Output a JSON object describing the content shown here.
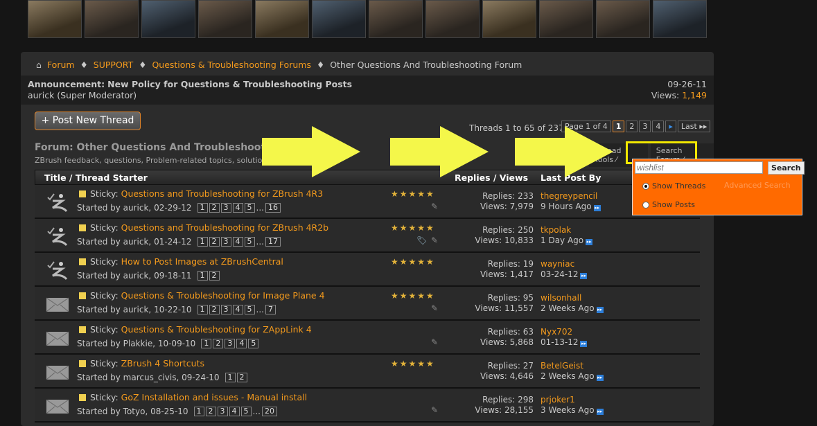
{
  "breadcrumb": {
    "items": [
      "Forum",
      "SUPPORT",
      "Questions & Troubleshooting Forums"
    ],
    "current": "Other Questions And Troubleshooting Forum"
  },
  "announcement": {
    "label": "Announcement:",
    "title": "New Policy for Questions & Troubleshooting Posts",
    "author": "aurick (Super Moderator)",
    "date": "09-26-11",
    "views_label": "Views:",
    "views": "1,149"
  },
  "post_button": "+ Post New Thread",
  "thread_count": "Threads 1 to 65 of 237",
  "pager": {
    "label": "Page 1 of 4",
    "pages": [
      "1",
      "2",
      "3",
      "4"
    ],
    "next": "▸",
    "last": "Last ▸▸"
  },
  "forum": {
    "title": "Forum: Other Questions And Troubleshooting Forum",
    "description": "ZBrush feedback, questions, Problem-related topics, solutions and suggestions"
  },
  "tabs": {
    "tools": "Thread Tools ⁄",
    "search": "Search Forum ⁄"
  },
  "columns": {
    "title": "Title / Thread Starter",
    "replies": "Replies / Views",
    "last": "Last Post By"
  },
  "threads": [
    {
      "prefix": "Sticky:",
      "title": "Questions and Troubleshooting for ZBrush 4R3",
      "starter": "Started by aurick, 02-29-12",
      "pages": [
        "1",
        "2",
        "3",
        "4",
        "5",
        "...",
        "16"
      ],
      "stars": "★★★★★",
      "replies": "Replies: 233",
      "views": "Views: 7,979",
      "last_user": "thegreypencil",
      "last_time": "9 Hours Ago",
      "icon": "zbrush"
    },
    {
      "prefix": "Sticky:",
      "title": "Questions and Troubleshooting for ZBrush 4R2b",
      "starter": "Started by aurick, 01-24-12",
      "pages": [
        "1",
        "2",
        "3",
        "4",
        "5",
        "...",
        "17"
      ],
      "stars": "★★★★★",
      "replies": "Replies: 250",
      "views": "Views: 10,833",
      "last_user": "tkpolak",
      "last_time": "1 Day Ago",
      "icon": "zbrush",
      "tag": true
    },
    {
      "prefix": "Sticky:",
      "title": "How to Post Images at ZBrushCentral",
      "starter": "Started by aurick, 09-18-11",
      "pages": [
        "1",
        "2"
      ],
      "stars": "★★★★★",
      "replies": "Replies: 19",
      "views": "Views: 1,417",
      "last_user": "wayniac",
      "last_time": "03-24-12",
      "icon": "zbrush",
      "nopen": true
    },
    {
      "prefix": "Sticky:",
      "title": "Questions & Troubleshooting for Image Plane 4",
      "starter": "Started by aurick, 10-22-10",
      "pages": [
        "1",
        "2",
        "3",
        "4",
        "5",
        "...",
        "7"
      ],
      "stars": "★★★★★",
      "replies": "Replies: 95",
      "views": "Views: 11,557",
      "last_user": "wilsonhall",
      "last_time": "2 Weeks Ago",
      "icon": "envelope"
    },
    {
      "prefix": "Sticky:",
      "title": "Questions & Troubleshooting for ZAppLink 4",
      "starter": "Started by Plakkie, 10-09-10",
      "pages": [
        "1",
        "2",
        "3",
        "4",
        "5"
      ],
      "stars": "",
      "replies": "Replies: 63",
      "views": "Views: 5,868",
      "last_user": "Nyx702",
      "last_time": "01-13-12",
      "icon": "envelope"
    },
    {
      "prefix": "Sticky:",
      "title": "ZBrush 4 Shortcuts",
      "starter": "Started by marcus_civis, 09-24-10",
      "pages": [
        "1",
        "2"
      ],
      "stars": "★★★★★",
      "replies": "Replies: 27",
      "views": "Views: 4,646",
      "last_user": "BetelGeist",
      "last_time": "2 Weeks Ago",
      "icon": "envelope",
      "nopen": true
    },
    {
      "prefix": "Sticky:",
      "title": "GoZ Installation and issues - Manual install",
      "starter": "Started by Totyo, 08-25-10",
      "pages": [
        "1",
        "2",
        "3",
        "4",
        "5",
        "...",
        "20"
      ],
      "stars": "",
      "replies": "Replies: 298",
      "views": "Views: 28,155",
      "last_user": "prjoker1",
      "last_time": "3 Weeks Ago",
      "icon": "envelope"
    }
  ],
  "search_popup": {
    "value": "wishlist",
    "button": "Search",
    "show_threads": "Show Threads",
    "show_posts": "Show Posts",
    "advanced": "Advanced Search"
  },
  "colors": {
    "accent": "#f39a1d",
    "popup": "#ff6a00",
    "arrow": "#f4f74a",
    "highlight": "#f2e800"
  }
}
